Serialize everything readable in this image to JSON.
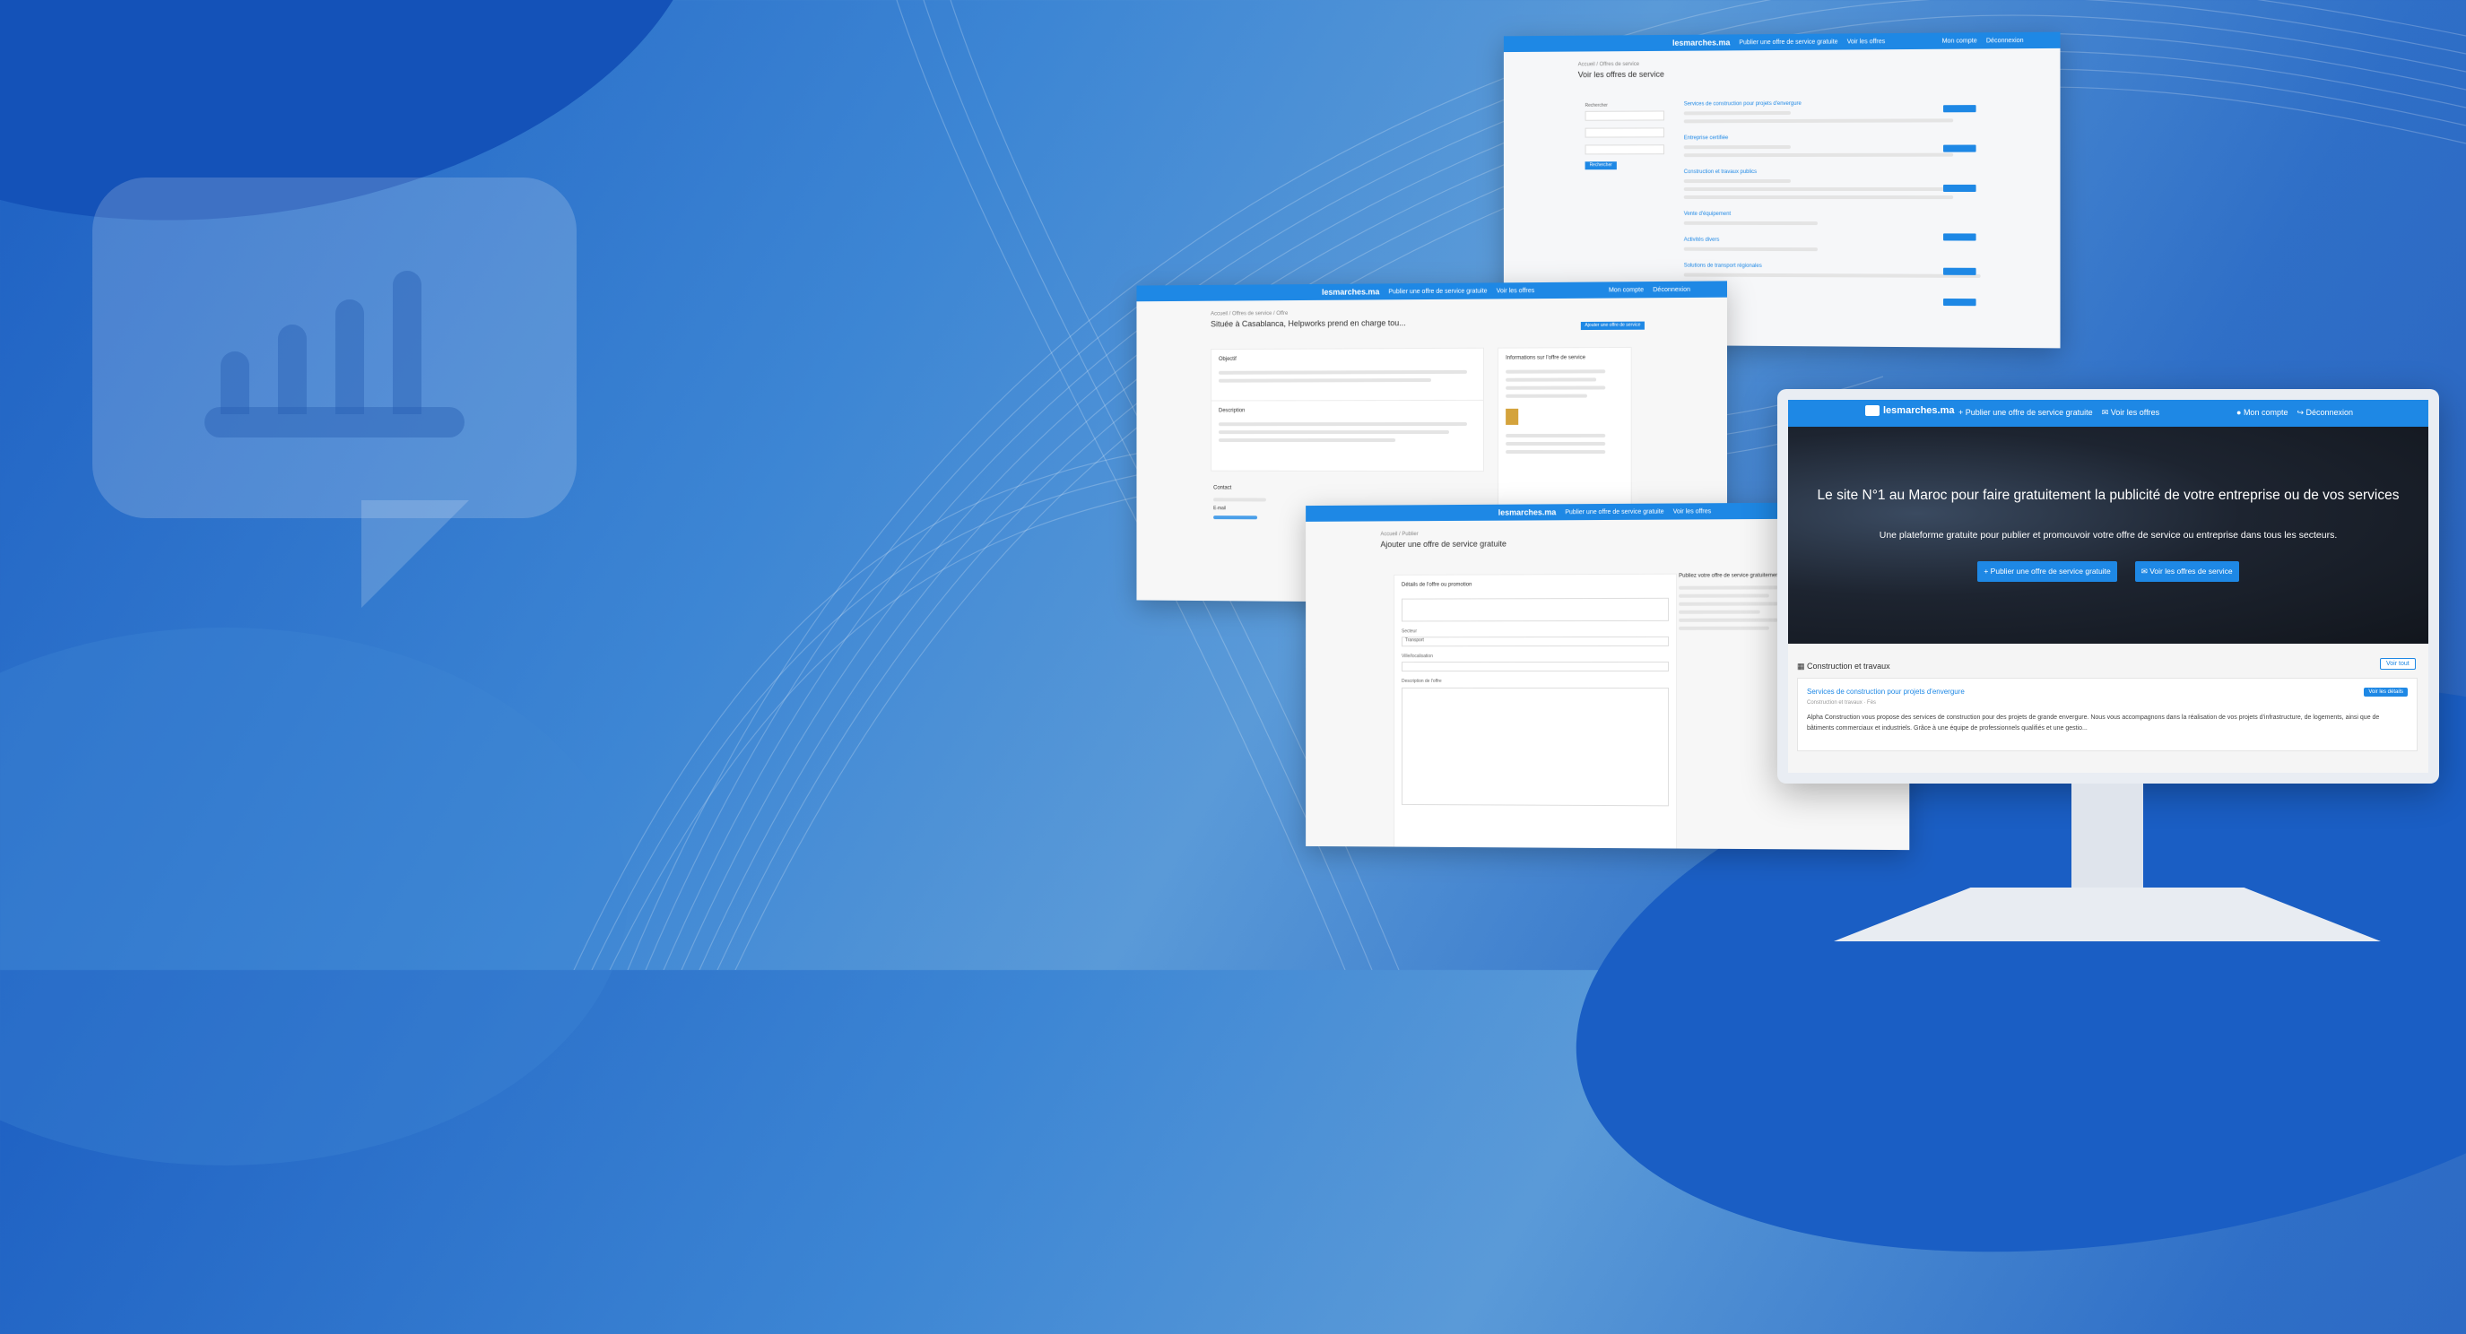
{
  "brand": {
    "logo": "lesmarches.ma",
    "accent": "#1e88e5",
    "background": "#2a6fc8"
  },
  "nav": {
    "publish": "Publier une offre de service gratuite",
    "offers": "Voir les offres",
    "account": "Mon compte",
    "logout": "Déconnexion"
  },
  "shot_offers": {
    "crumb": "Accueil / Offres de service",
    "title": "Voir les offres de service",
    "filter_label": "Rechercher",
    "submit": "Rechercher",
    "items": [
      "Services de construction pour projets d'envergure",
      "Entreprise certifiée",
      "Construction et travaux publics",
      "Vente d'équipement",
      "Activités divers",
      "Solutions de transport régionales"
    ]
  },
  "shot_detail": {
    "crumb": "Accueil / Offres de service / Offre",
    "title": "Située à Casablanca, Helpworks prend en charge tou...",
    "action": "Ajouter une offre de service",
    "objective_label": "Objectif",
    "description_label": "Description",
    "info_label": "Informations sur l'offre de service",
    "contact_label": "Contact",
    "email_label": "E-mail"
  },
  "shot_form": {
    "crumb": "Accueil / Publier",
    "title": "Ajouter une offre de service gratuite",
    "section": "Détails de l'offre ou promotion",
    "sector_label": "Secteur",
    "sector_value": "Transport",
    "city_label": "Ville/localisation",
    "desc_label": "Description de l'offre",
    "side_title": "Publiez votre offre de service gratuitement"
  },
  "home": {
    "hero_title": "Le site N°1 au Maroc pour faire gratuitement la publicité de votre entreprise ou de vos services",
    "hero_subtitle": "Une plateforme gratuite pour publier et promouvoir votre offre de service ou entreprise dans tous les secteurs.",
    "btn_publish": "Publier une offre de service gratuite",
    "btn_view": "Voir les offres de service",
    "section_title": "Construction et travaux",
    "see_all": "Voir tout",
    "card": {
      "title": "Services de construction pour projets d'envergure",
      "meta": "Construction et travaux · Fès",
      "button": "Voir les détails",
      "description": "Alpha Construction vous propose des services de construction pour des projets de grande envergure. Nous vous accompagnons dans la réalisation de vos projets d'infrastructure, de logements, ainsi que de bâtiments commerciaux et industriels. Grâce à une équipe de professionnels qualifiés et une gestio..."
    }
  }
}
